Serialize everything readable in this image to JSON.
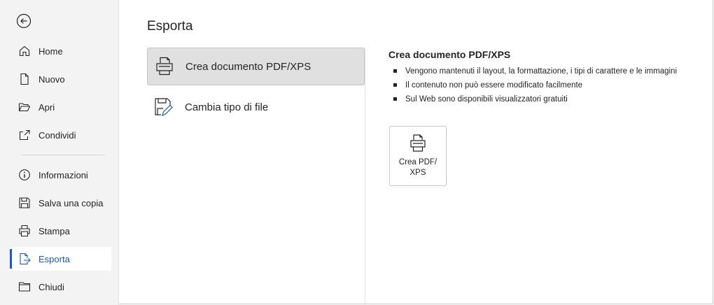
{
  "sidebar": {
    "back_icon": "back-arrow-circle-icon",
    "items": [
      {
        "label": "Home",
        "icon": "home-icon"
      },
      {
        "label": "Nuovo",
        "icon": "new-document-icon"
      },
      {
        "label": "Apri",
        "icon": "folder-open-icon"
      },
      {
        "label": "Condividi",
        "icon": "share-icon"
      },
      {
        "label": "Informazioni",
        "icon": "info-icon"
      },
      {
        "label": "Salva una copia",
        "icon": "save-copy-icon"
      },
      {
        "label": "Stampa",
        "icon": "printer-icon"
      },
      {
        "label": "Esporta",
        "icon": "export-icon",
        "selected": true
      },
      {
        "label": "Chiudi",
        "icon": "close-folder-icon"
      }
    ]
  },
  "main": {
    "title": "Esporta",
    "options": [
      {
        "label": "Crea documento PDF/XPS",
        "icon": "pdf-printer-icon",
        "selected": true
      },
      {
        "label": "Cambia tipo di file",
        "icon": "change-file-type-icon"
      }
    ]
  },
  "detail": {
    "title": "Crea documento PDF/XPS",
    "bullets": [
      "Vengono mantenuti il layout, la formattazione, i tipi di carattere e le immagini",
      "Il contenuto non può essere modificato facilmente",
      "Sul Web sono disponibili visualizzatori gratuiti"
    ],
    "button_line1": "Crea PDF/",
    "button_line2": "XPS"
  },
  "colors": {
    "accent": "#185abd",
    "sidebar_bg": "#f3f3f3",
    "selected_option_bg": "#e0e0e0"
  }
}
